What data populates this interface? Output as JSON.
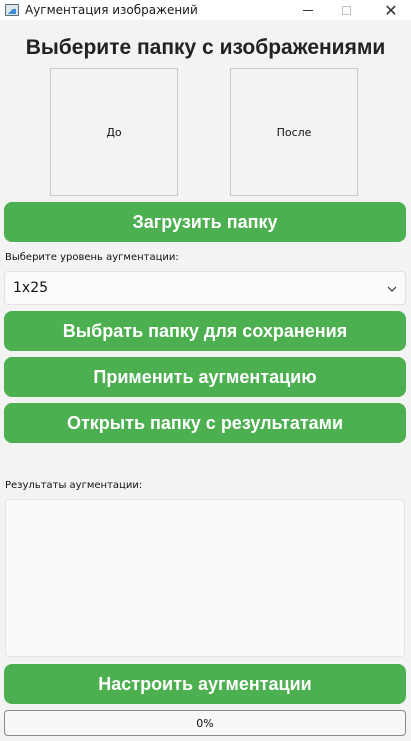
{
  "window": {
    "title": "Аугментация изображений",
    "controls": {
      "minimize": "",
      "maximize": "",
      "close": "✕"
    }
  },
  "header": {
    "title": "Выберите папку с изображениями"
  },
  "previews": {
    "before": "До",
    "after": "После"
  },
  "buttons": {
    "load_folder": "Загрузить папку",
    "choose_save_folder": "Выбрать папку для сохранения",
    "apply": "Применить аугментацию",
    "open_results": "Открыть папку с результатами",
    "configure": "Настроить аугментации"
  },
  "augmentation_level": {
    "label": "Выберите уровень аугментации:",
    "selected": "1x25"
  },
  "results": {
    "label": "Результаты аугментации:",
    "text": ""
  },
  "progress": {
    "value": 0,
    "text": "0%"
  },
  "colors": {
    "accent": "#4caf50",
    "background": "#f3f3f3"
  },
  "icons": {
    "app": "image-icon",
    "dropdown": "chevron-down-icon"
  }
}
